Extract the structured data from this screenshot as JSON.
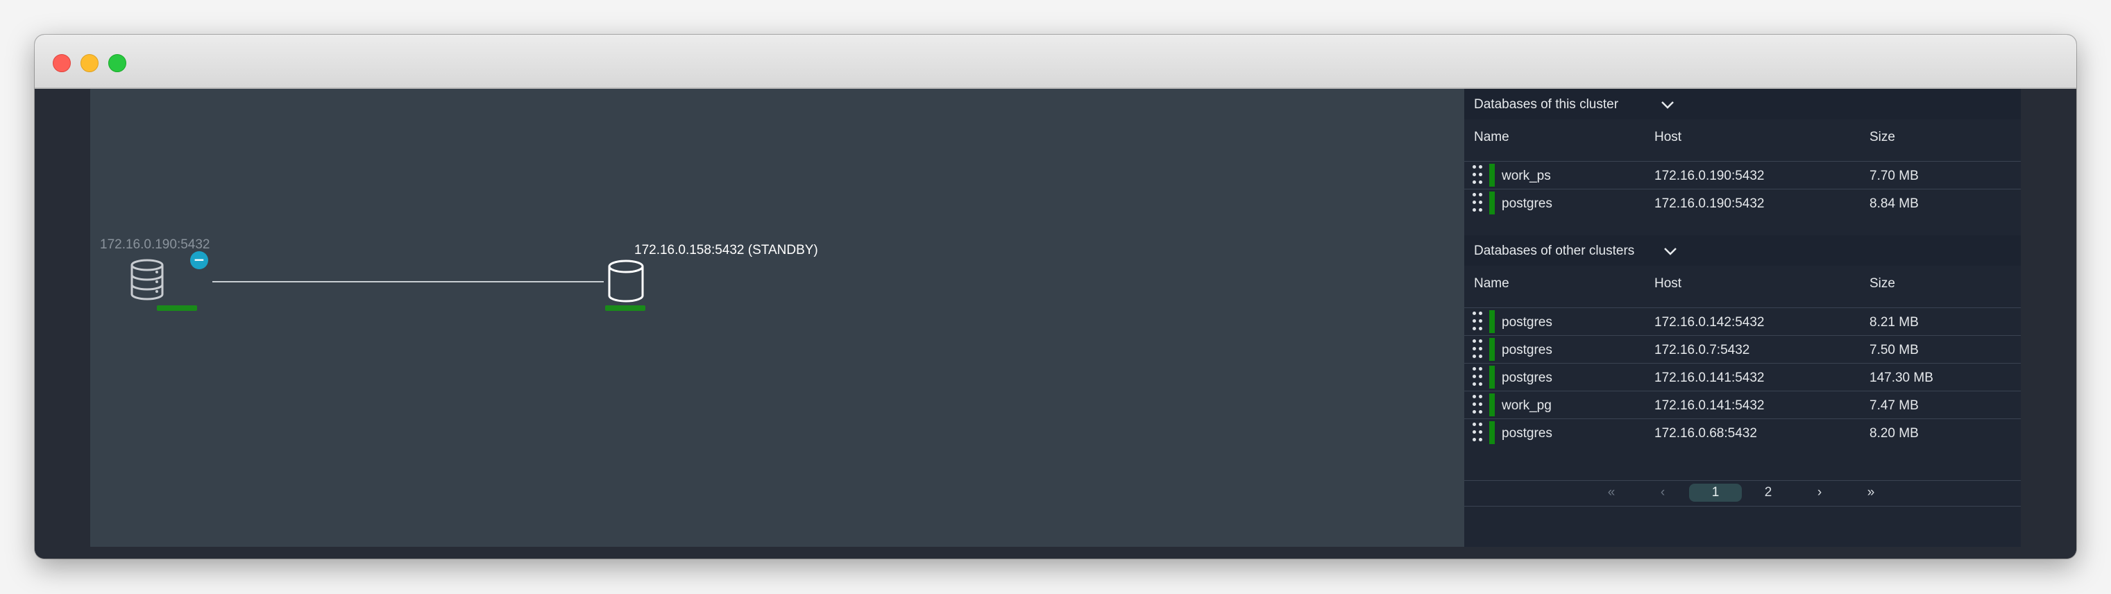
{
  "topology": {
    "primary_node": {
      "label": "172.16.0.190:5432",
      "badge": "−",
      "icon": "database-stack-icon"
    },
    "standby_node": {
      "label": "172.16.0.158:5432 (STANDBY)",
      "icon": "database-icon"
    }
  },
  "this_cluster": {
    "title": "Databases of this cluster",
    "columns": {
      "name": "Name",
      "host": "Host",
      "size": "Size"
    },
    "rows": [
      {
        "name": "work_ps",
        "host": "172.16.0.190:5432",
        "size": "7.70 MB"
      },
      {
        "name": "postgres",
        "host": "172.16.0.190:5432",
        "size": "8.84 MB"
      }
    ]
  },
  "other_clusters": {
    "title": "Databases of other clusters",
    "columns": {
      "name": "Name",
      "host": "Host",
      "size": "Size"
    },
    "rows": [
      {
        "name": "postgres",
        "host": "172.16.0.142:5432",
        "size": "8.21 MB"
      },
      {
        "name": "postgres",
        "host": "172.16.0.7:5432",
        "size": "7.50 MB"
      },
      {
        "name": "postgres",
        "host": "172.16.0.141:5432",
        "size": "147.30 MB"
      },
      {
        "name": "work_pg",
        "host": "172.16.0.141:5432",
        "size": "7.47 MB"
      },
      {
        "name": "postgres",
        "host": "172.16.0.68:5432",
        "size": "8.20 MB"
      }
    ]
  },
  "pagination": {
    "first": "«",
    "prev": "‹",
    "pages": [
      "1",
      "2"
    ],
    "current": "1",
    "next": "›",
    "last": "»"
  },
  "colors": {
    "status_ok": "#0f8a0f",
    "badge": "#1aa3c8",
    "panel_bg": "#1f2633",
    "canvas_bg": "#37414b"
  }
}
